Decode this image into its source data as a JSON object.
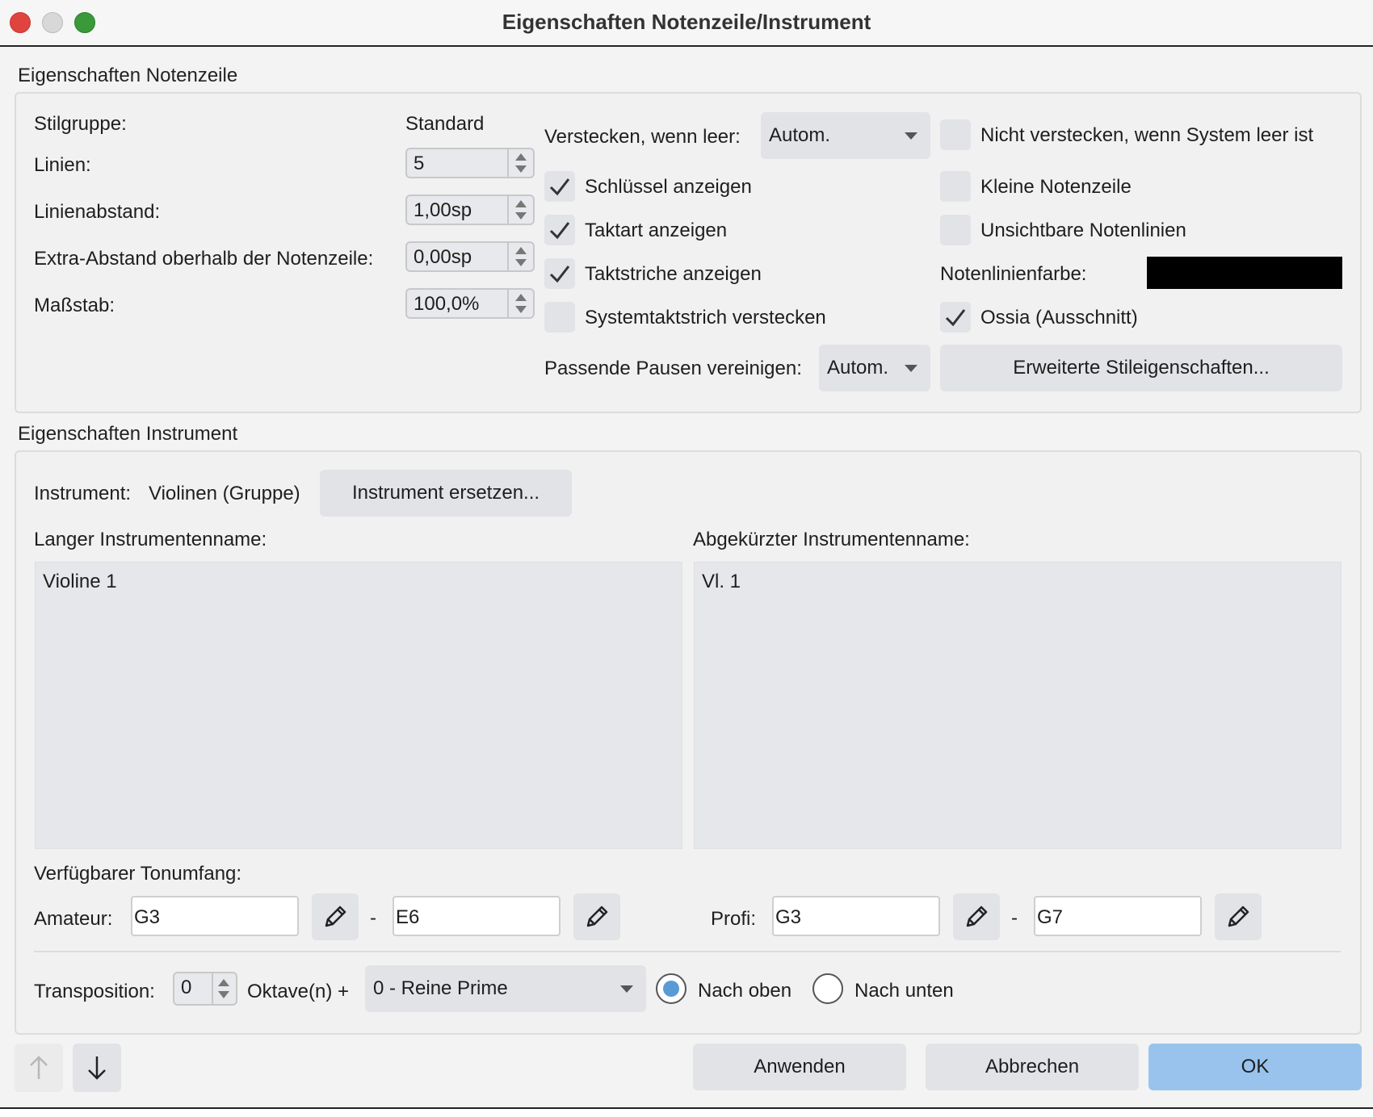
{
  "window": {
    "title": "Eigenschaften Notenzeile/Instrument"
  },
  "staff": {
    "section_title": "Eigenschaften Notenzeile",
    "style_group_label": "Stilgruppe:",
    "style_group_value": "Standard",
    "lines_label": "Linien:",
    "lines_value": "5",
    "line_spacing_label": "Linienabstand:",
    "line_spacing_value": "1,00sp",
    "extra_space_label": "Extra-Abstand oberhalb der Notenzeile:",
    "extra_space_value": "0,00sp",
    "scale_label": "Maßstab:",
    "scale_value": "100,0%",
    "hide_when_empty_label": "Verstecken, wenn leer:",
    "hide_when_empty_value": "Autom.",
    "show_clef_label": "Schlüssel anzeigen",
    "show_clef_checked": true,
    "show_timesig_label": "Taktart anzeigen",
    "show_timesig_checked": true,
    "show_barlines_label": "Taktstriche anzeigen",
    "show_barlines_checked": true,
    "hide_system_barline_label": "Systemtaktstrich verstecken",
    "hide_system_barline_checked": false,
    "merge_rests_label": "Passende Pausen vereinigen:",
    "merge_rests_value": "Autom.",
    "dont_hide_label": "Nicht verstecken, wenn System leer ist",
    "dont_hide_checked": false,
    "small_staff_label": "Kleine Notenzeile",
    "small_staff_checked": false,
    "invisible_lines_label": "Unsichtbare Notenlinien",
    "invisible_lines_checked": false,
    "line_color_label": "Notenlinienfarbe:",
    "line_color": "#000000",
    "ossia_label": "Ossia (Ausschnitt)",
    "ossia_checked": true,
    "advanced_style_button": "Erweiterte Stileigenschaften..."
  },
  "instrument": {
    "section_title": "Eigenschaften Instrument",
    "instrument_label": "Instrument:",
    "instrument_value": "Violinen (Gruppe)",
    "replace_button": "Instrument ersetzen...",
    "long_name_label": "Langer Instrumentenname:",
    "long_name_value": "Violine 1",
    "short_name_label": "Abgekürzter Instrumentenname:",
    "short_name_value": "Vl. 1",
    "range_label": "Verfügbarer Tonumfang:",
    "amateur_label": "Amateur:",
    "amateur_low": "G3",
    "amateur_high": "E6",
    "pro_label": "Profi:",
    "pro_low": "G3",
    "pro_high": "G7",
    "dash": "-",
    "transposition_label": "Transposition:",
    "octaves_value": "0",
    "octaves_label": "Oktave(n) +",
    "interval_value": "0 - Reine Prime",
    "up_label": "Nach oben",
    "down_label": "Nach unten"
  },
  "footer": {
    "apply_button": "Anwenden",
    "cancel_button": "Abbrechen",
    "ok_button": "OK"
  },
  "colors": {
    "accent": "#99c3ec",
    "radio_selected": "#5b9bd5",
    "close": "#ee4a3f",
    "minimize": "#d9d9d9",
    "zoom": "#3aa33a"
  }
}
